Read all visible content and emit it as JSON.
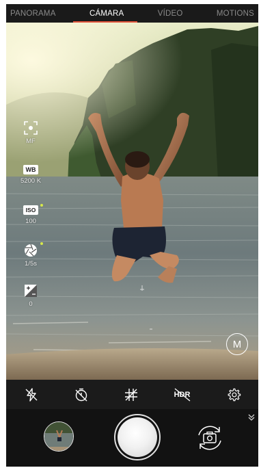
{
  "modes": {
    "items": [
      "PANORAMA",
      "CÁMARA",
      "VÍDEO",
      "MOTIONS"
    ],
    "active": "CÁMARA"
  },
  "manual_controls": {
    "focus": {
      "value": "MF",
      "icon": "focus-icon"
    },
    "white_balance": {
      "icon_text": "WB",
      "value": "5200 K"
    },
    "iso": {
      "icon_text": "ISO",
      "value": "100"
    },
    "shutter_speed": {
      "value": "1/5s",
      "icon": "aperture-icon"
    },
    "exposure": {
      "value": "0",
      "icon": "exposure-icon"
    }
  },
  "mode_button": {
    "label": "M"
  },
  "toolbar": {
    "flash": "flash-off-icon",
    "timer": "timer-off-icon",
    "grid": "grid-icon",
    "hdr": {
      "label": "HDR",
      "state": "off"
    },
    "settings": "settings-icon"
  },
  "bottom": {
    "gallery": "gallery-thumbnail",
    "shutter": "shutter-button",
    "switch_camera": "switch-camera-icon",
    "expand": "chevron-double-down-icon"
  },
  "colors": {
    "accent": "#e2533a",
    "indicator": "#d6e84a"
  }
}
